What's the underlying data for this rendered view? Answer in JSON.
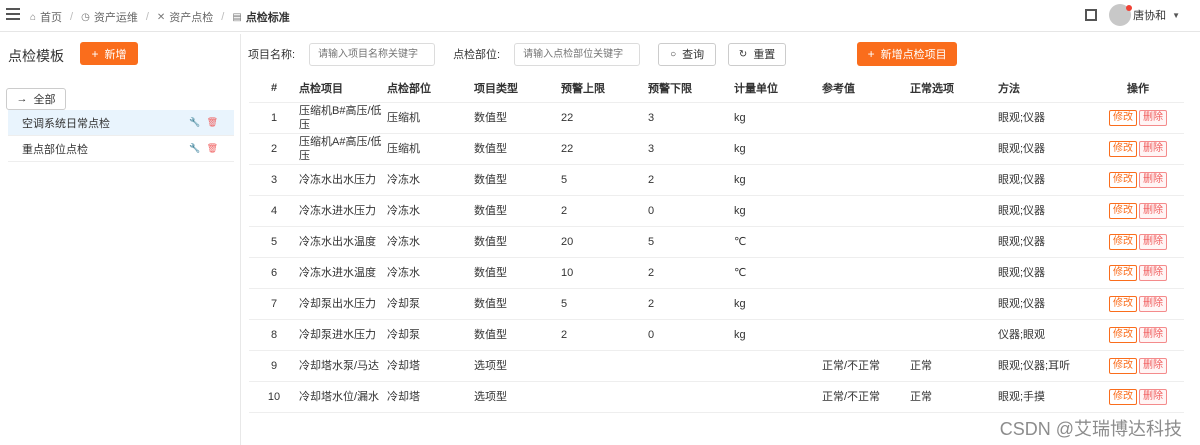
{
  "breadcrumbs": [
    {
      "label": "首页",
      "icon": "home-icon"
    },
    {
      "label": "资产运维",
      "icon": "clock-icon"
    },
    {
      "label": "资产点检",
      "icon": "tools-icon"
    },
    {
      "label": "点检标准",
      "icon": "document-icon"
    }
  ],
  "user": {
    "name": "唐协和"
  },
  "left": {
    "title": "点检模板",
    "add_label": "新增",
    "all_label": "全部",
    "templates": [
      {
        "label": "空调系统日常点检",
        "active": true
      },
      {
        "label": "重点部位点检",
        "active": false
      }
    ]
  },
  "filters": {
    "item_name_label": "项目名称:",
    "item_name_placeholder": "请输入项目名称关键字",
    "part_label": "点检部位:",
    "part_placeholder": "请输入点检部位关键字",
    "query_label": "查询",
    "reset_label": "重置",
    "add_item_label": "新增点检项目"
  },
  "table": {
    "headers": [
      "#",
      "点检项目",
      "点检部位",
      "项目类型",
      "预警上限",
      "预警下限",
      "计量单位",
      "参考值",
      "正常选项",
      "方法",
      "操作"
    ],
    "edit_label": "修改",
    "delete_label": "删除",
    "rows": [
      {
        "n": "1",
        "item": "压缩机B#高压/低压",
        "part": "压缩机",
        "type": "数值型",
        "upper": "22",
        "lower": "3",
        "unit": "kg",
        "ref": "",
        "normal": "",
        "method": "眼观;仪器"
      },
      {
        "n": "2",
        "item": "压缩机A#高压/低压",
        "part": "压缩机",
        "type": "数值型",
        "upper": "22",
        "lower": "3",
        "unit": "kg",
        "ref": "",
        "normal": "",
        "method": "眼观;仪器"
      },
      {
        "n": "3",
        "item": "冷冻水出水压力",
        "part": "冷冻水",
        "type": "数值型",
        "upper": "5",
        "lower": "2",
        "unit": "kg",
        "ref": "",
        "normal": "",
        "method": "眼观;仪器"
      },
      {
        "n": "4",
        "item": "冷冻水进水压力",
        "part": "冷冻水",
        "type": "数值型",
        "upper": "2",
        "lower": "0",
        "unit": "kg",
        "ref": "",
        "normal": "",
        "method": "眼观;仪器"
      },
      {
        "n": "5",
        "item": "冷冻水出水温度",
        "part": "冷冻水",
        "type": "数值型",
        "upper": "20",
        "lower": "5",
        "unit": "℃",
        "ref": "",
        "normal": "",
        "method": "眼观;仪器"
      },
      {
        "n": "6",
        "item": "冷冻水进水温度",
        "part": "冷冻水",
        "type": "数值型",
        "upper": "10",
        "lower": "2",
        "unit": "℃",
        "ref": "",
        "normal": "",
        "method": "眼观;仪器"
      },
      {
        "n": "7",
        "item": "冷却泵出水压力",
        "part": "冷却泵",
        "type": "数值型",
        "upper": "5",
        "lower": "2",
        "unit": "kg",
        "ref": "",
        "normal": "",
        "method": "眼观;仪器"
      },
      {
        "n": "8",
        "item": "冷却泵进水压力",
        "part": "冷却泵",
        "type": "数值型",
        "upper": "2",
        "lower": "0",
        "unit": "kg",
        "ref": "",
        "normal": "",
        "method": "仪器;眼观"
      },
      {
        "n": "9",
        "item": "冷却塔水泵/马达",
        "part": "冷却塔",
        "type": "选项型",
        "upper": "",
        "lower": "",
        "unit": "",
        "ref": "正常/不正常",
        "normal": "正常",
        "method": "眼观;仪器;耳听"
      },
      {
        "n": "10",
        "item": "冷却塔水位/漏水",
        "part": "冷却塔",
        "type": "选项型",
        "upper": "",
        "lower": "",
        "unit": "",
        "ref": "正常/不正常",
        "normal": "正常",
        "method": "眼观;手摸"
      }
    ]
  },
  "watermark": "CSDN @艾瑞博达科技"
}
